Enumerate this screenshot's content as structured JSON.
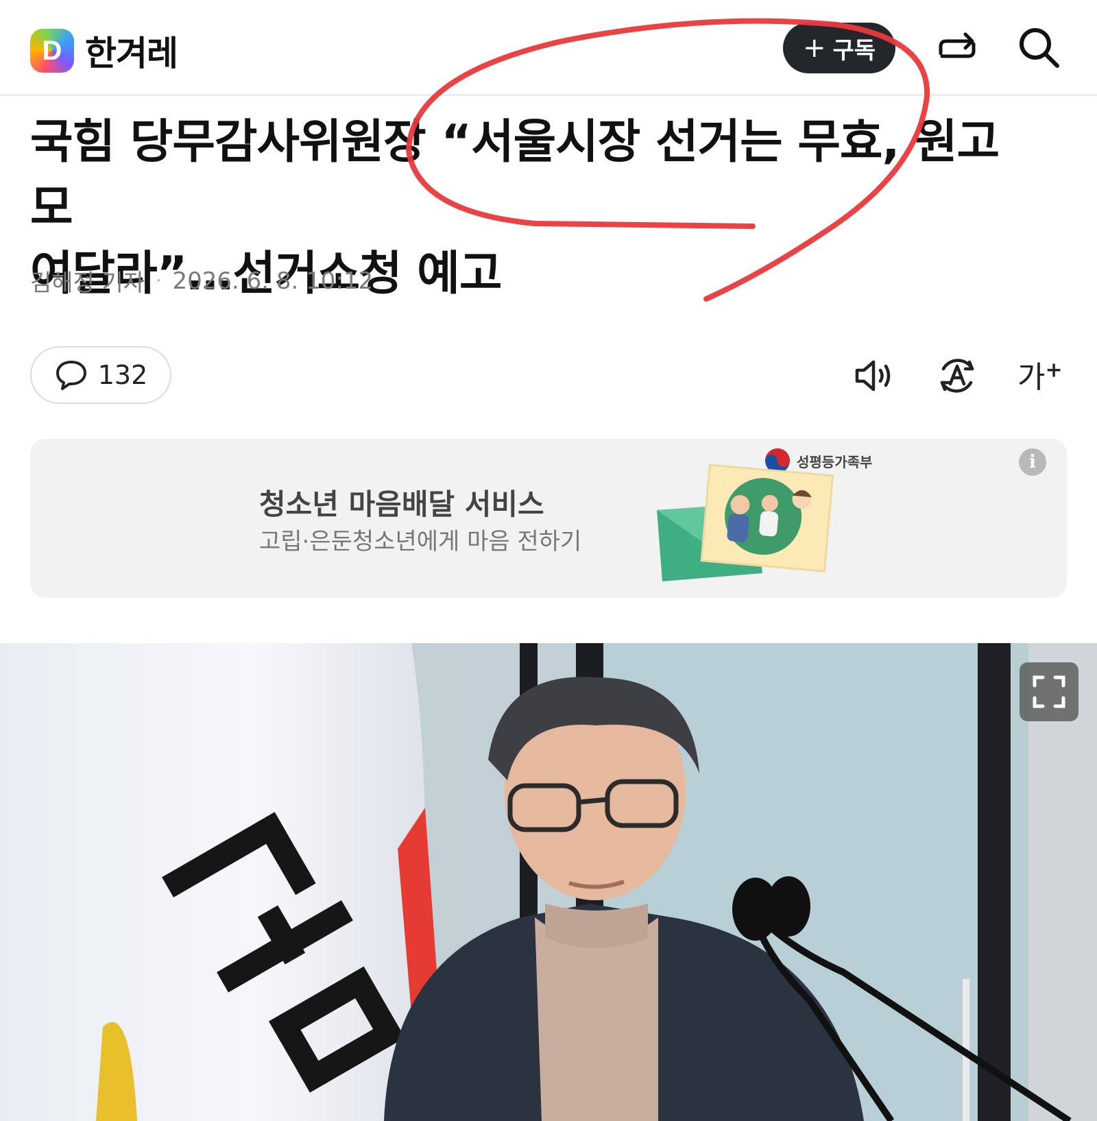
{
  "header": {
    "logo_letter": "D",
    "brand": "한겨레",
    "subscribe_label": "구독",
    "icons": [
      "share-icon",
      "search-icon"
    ]
  },
  "article": {
    "headline_line1": "국힘 당무감사위원장 “서울시장 선거는 무효, 원고 모",
    "headline_line2": "여달라”…선거소청 예고",
    "author": "김해정 기자",
    "datetime": "2026. 6. 8. 10:12"
  },
  "actions": {
    "comment_count": "132",
    "font_size_label": "가",
    "font_size_sup": "+",
    "icons": [
      "speaker-icon",
      "translate-icon",
      "font-size-icon"
    ]
  },
  "ad": {
    "title": "청소년 마음배달 서비스",
    "subtitle": "고립·은둔청소년에게 마음 전하기",
    "ministry": "성평등가족부",
    "info_symbol": "i"
  },
  "colors": {
    "annotation": "#e8393b",
    "subscribe_bg": "#23262b",
    "ad_bg": "#f2f2f2"
  }
}
